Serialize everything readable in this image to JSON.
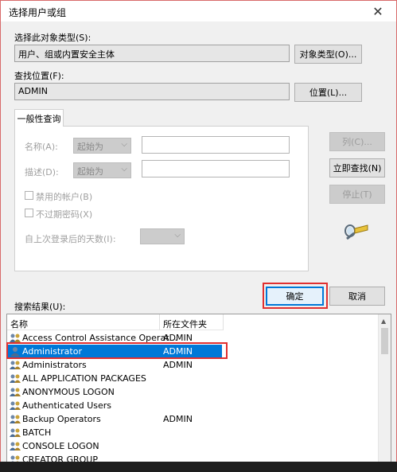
{
  "window": {
    "title": "选择用户或组",
    "close_glyph": "✕"
  },
  "object_type": {
    "label": "选择此对象类型(S):",
    "value": "用户、组或内置安全主体",
    "button": "对象类型(O)..."
  },
  "location": {
    "label": "查找位置(F):",
    "value": "ADMIN",
    "button": "位置(L)..."
  },
  "common_query": {
    "tab_label": "一般性查询",
    "name_label": "名称(A):",
    "name_mode": "起始为",
    "description_label": "描述(D):",
    "description_mode": "起始为",
    "disabled_accounts": "禁用的帐户(B)",
    "non_expiring_passwords": "不过期密码(X)",
    "days_since_logon_label": "自上次登录后的天数(I):",
    "chevron_glyph": "⌵"
  },
  "actions": {
    "columns": "列(C)...",
    "find_now": "立即查找(N)",
    "stop": "停止(T)",
    "ok": "确定",
    "cancel": "取消"
  },
  "results": {
    "label": "搜索结果(U):",
    "columns": [
      "名称",
      "所在文件夹"
    ],
    "selected_index": 1,
    "rows": [
      {
        "name": "Access Control Assistance Operat...",
        "folder": "ADMIN",
        "icon": "group-icon"
      },
      {
        "name": "Administrator",
        "folder": "ADMIN",
        "icon": "user-icon"
      },
      {
        "name": "Administrators",
        "folder": "ADMIN",
        "icon": "group-icon"
      },
      {
        "name": "ALL APPLICATION PACKAGES",
        "folder": "",
        "icon": "group-icon"
      },
      {
        "name": "ANONYMOUS LOGON",
        "folder": "",
        "icon": "group-icon"
      },
      {
        "name": "Authenticated Users",
        "folder": "",
        "icon": "group-icon"
      },
      {
        "name": "Backup Operators",
        "folder": "ADMIN",
        "icon": "group-icon"
      },
      {
        "name": "BATCH",
        "folder": "",
        "icon": "group-icon"
      },
      {
        "name": "CONSOLE LOGON",
        "folder": "",
        "icon": "group-icon"
      },
      {
        "name": "CREATOR GROUP",
        "folder": "",
        "icon": "group-icon"
      }
    ]
  },
  "colors": {
    "accent": "#0078d7",
    "annotation": "#e03030"
  }
}
